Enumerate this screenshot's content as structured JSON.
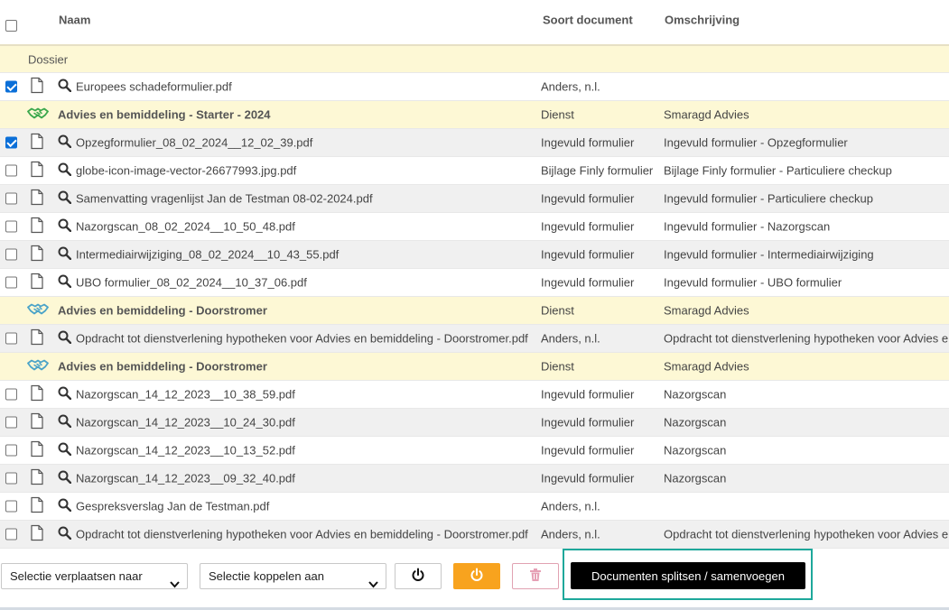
{
  "header": {
    "name": "Naam",
    "soort": "Soort document",
    "omschrijving": "Omschrijving"
  },
  "dossier_label": "Dossier",
  "rows": [
    {
      "type": "doc",
      "checked": true,
      "name": "Europees schadeformulier.pdf",
      "soort": "Anders, n.l.",
      "omschrijving": ""
    },
    {
      "type": "group",
      "icon_color": "#3aa74c",
      "name": "Advies en bemiddeling - Starter - 2024",
      "soort": "Dienst",
      "omschrijving": "Smaragd Advies"
    },
    {
      "type": "doc",
      "checked": true,
      "name": "Opzegformulier_08_02_2024__12_02_39.pdf",
      "soort": "Ingevuld formulier",
      "omschrijving": "Ingevuld formulier - Opzegformulier"
    },
    {
      "type": "doc",
      "checked": false,
      "name": "globe-icon-image-vector-26677993.jpg.pdf",
      "soort": "Bijlage Finly formulier",
      "omschrijving": "Bijlage Finly formulier - Particuliere checkup"
    },
    {
      "type": "doc",
      "checked": false,
      "name": "Samenvatting vragenlijst Jan de Testman 08-02-2024.pdf",
      "soort": "Ingevuld formulier",
      "omschrijving": "Ingevuld formulier - Particuliere checkup"
    },
    {
      "type": "doc",
      "checked": false,
      "name": "Nazorgscan_08_02_2024__10_50_48.pdf",
      "soort": "Ingevuld formulier",
      "omschrijving": "Ingevuld formulier - Nazorgscan"
    },
    {
      "type": "doc",
      "checked": false,
      "name": "Intermediairwijziging_08_02_2024__10_43_55.pdf",
      "soort": "Ingevuld formulier",
      "omschrijving": "Ingevuld formulier - Intermediairwijziging"
    },
    {
      "type": "doc",
      "checked": false,
      "name": "UBO formulier_08_02_2024__10_37_06.pdf",
      "soort": "Ingevuld formulier",
      "omschrijving": "Ingevuld formulier - UBO formulier"
    },
    {
      "type": "group",
      "icon_color": "#4aa3c8",
      "name": "Advies en bemiddeling - Doorstromer",
      "soort": "Dienst",
      "omschrijving": "Smaragd Advies"
    },
    {
      "type": "doc",
      "checked": false,
      "name": "Opdracht tot dienstverlening hypotheken voor Advies en bemiddeling - Doorstromer.pdf",
      "soort": "Anders, n.l.",
      "omschrijving": "Opdracht tot dienstverlening hypotheken voor Advies en bemiddeling - Doorstromer"
    },
    {
      "type": "group",
      "icon_color": "#4aa3c8",
      "name": "Advies en bemiddeling - Doorstromer",
      "soort": "Dienst",
      "omschrijving": "Smaragd Advies"
    },
    {
      "type": "doc",
      "checked": false,
      "name": "Nazorgscan_14_12_2023__10_38_59.pdf",
      "soort": "Ingevuld formulier",
      "omschrijving": "Nazorgscan"
    },
    {
      "type": "doc",
      "checked": false,
      "name": "Nazorgscan_14_12_2023__10_24_30.pdf",
      "soort": "Ingevuld formulier",
      "omschrijving": "Nazorgscan"
    },
    {
      "type": "doc",
      "checked": false,
      "name": "Nazorgscan_14_12_2023__10_13_52.pdf",
      "soort": "Ingevuld formulier",
      "omschrijving": "Nazorgscan"
    },
    {
      "type": "doc",
      "checked": false,
      "name": "Nazorgscan_14_12_2023__09_32_40.pdf",
      "soort": "Ingevuld formulier",
      "omschrijving": "Nazorgscan"
    },
    {
      "type": "doc",
      "checked": false,
      "name": "Gespreksverslag Jan de Testman.pdf",
      "soort": "Anders, n.l.",
      "omschrijving": ""
    },
    {
      "type": "doc",
      "checked": false,
      "name": "Opdracht tot dienstverlening hypotheken voor Advies en bemiddeling - Doorstromer.pdf",
      "soort": "Anders, n.l.",
      "omschrijving": "Opdracht tot dienstverlening hypotheken voor Advies en bemiddeling - Doorstromer"
    }
  ],
  "toolbar": {
    "move_select": "Selectie verplaatsen naar",
    "link_select": "Selectie koppelen aan",
    "split_button": "Documenten splitsen / samenvoegen"
  },
  "colors": {
    "accent_orange": "#f8a31e",
    "highlight_teal": "#1ea89b",
    "checkbox_blue": "#0b6fd8"
  }
}
